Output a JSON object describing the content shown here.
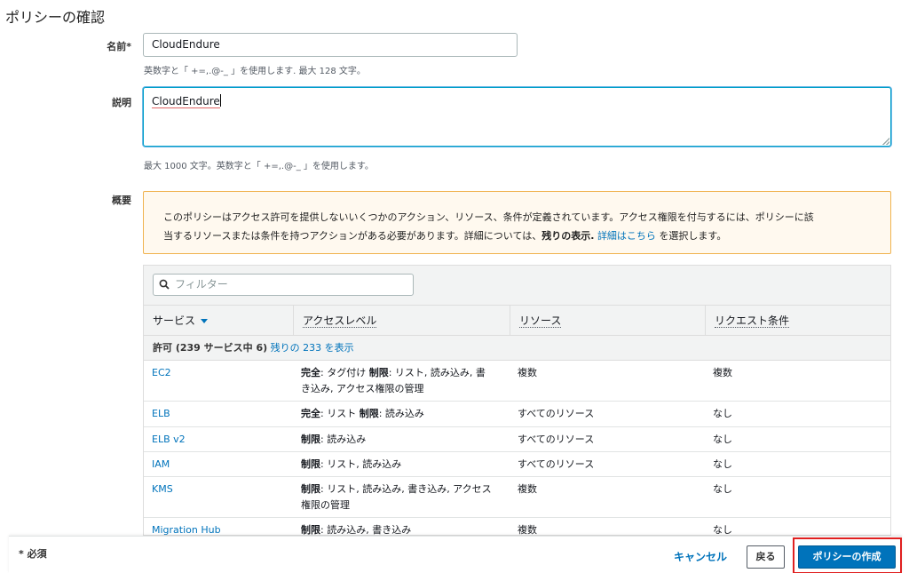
{
  "page": {
    "title": "ポリシーの確認"
  },
  "name_field": {
    "label": "名前*",
    "value": "CloudEndure",
    "hint": "英数字と「 +=,.@-_ 」を使用します. 最大 128 文字。"
  },
  "description_field": {
    "label": "説明",
    "value": "CloudEndure",
    "hint": "最大 1000 文字。英数字と「 +=,.@-_ 」を使用します。"
  },
  "summary": {
    "label": "概要",
    "warning_text_1": "このポリシーはアクセス許可を提供しないいくつかのアクション、リソース、条件が定義されています。アクセス権限を付与するには、ポリシーに該",
    "warning_text_2": "当するリソースまたは条件を持つアクションがある必要があります。詳細については、",
    "warning_bold": "残りの表示.",
    "warning_link": "詳細はこちら",
    "warning_tail": "を選択します。"
  },
  "table": {
    "filter_placeholder": "フィルター",
    "columns": [
      "サービス",
      "アクセスレベル",
      "リソース",
      "リクエスト条件"
    ],
    "group": {
      "label": "許可 (239 サービス中 6)",
      "link": "残りの 233 を表示"
    },
    "rows": [
      {
        "service": "EC2",
        "access_bold1": "完全",
        "access_text1": ": タグ付け ",
        "access_bold2": "制限",
        "access_text2": ": リスト, 読み込み, 書",
        "access_line2": "き込み, アクセス権限の管理",
        "resource": "複数",
        "condition": "複数"
      },
      {
        "service": "ELB",
        "access_bold1": "完全",
        "access_text1": ": リスト ",
        "access_bold2": "制限",
        "access_text2": ": 読み込み",
        "access_line2": "",
        "resource": "すべてのリソース",
        "condition": "なし"
      },
      {
        "service": "ELB v2",
        "access_bold1": "制限",
        "access_text1": ": 読み込み",
        "access_bold2": "",
        "access_text2": "",
        "access_line2": "",
        "resource": "すべてのリソース",
        "condition": "なし"
      },
      {
        "service": "IAM",
        "access_bold1": "制限",
        "access_text1": ": リスト, 読み込み",
        "access_bold2": "",
        "access_text2": "",
        "access_line2": "",
        "resource": "すべてのリソース",
        "condition": "なし"
      },
      {
        "service": "KMS",
        "access_bold1": "制限",
        "access_text1": ": リスト, 読み込み, 書き込み, アクセス",
        "access_bold2": "",
        "access_text2": "",
        "access_line2": "権限の管理",
        "resource": "複数",
        "condition": "なし"
      },
      {
        "service": "Migration Hub",
        "access_bold1": "制限",
        "access_text1": ": 読み込み, 書き込み",
        "access_bold2": "",
        "access_text2": "",
        "access_line2": "",
        "resource": "複数",
        "condition": "なし"
      }
    ]
  },
  "footer": {
    "required_note": "* 必須",
    "cancel_label": "キャンセル",
    "back_label": "戻る",
    "create_label": "ポリシーの作成"
  }
}
